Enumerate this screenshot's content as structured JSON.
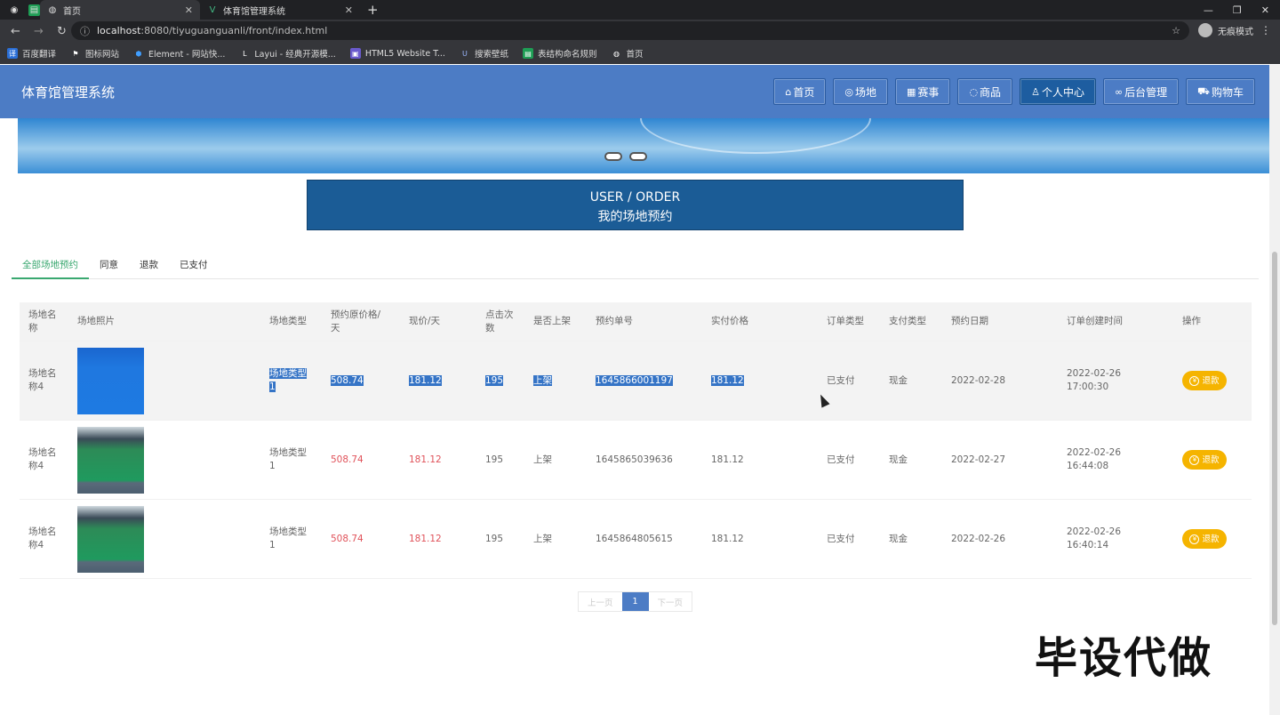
{
  "browser": {
    "tabs": [
      {
        "title": "首页",
        "active": true
      },
      {
        "title": "体育馆管理系统",
        "active": false
      }
    ],
    "url_host": "localhost",
    "url_rest": ":8080/tiyuguanguanli/front/index.html",
    "incognito_label": "无痕模式",
    "bookmarks": [
      "百度翻译",
      "图标网站",
      "Element - 网站快...",
      "Layui - 经典开源模...",
      "HTML5 Website T...",
      "搜索壁纸",
      "表结构命名规则",
      "首页"
    ]
  },
  "site": {
    "brand": "体育馆管理系统",
    "nav": [
      {
        "icon": "home-icon",
        "glyph": "⌂",
        "label": "首页",
        "active": false
      },
      {
        "icon": "venue-icon",
        "glyph": "◎",
        "label": "场地",
        "active": false
      },
      {
        "icon": "calendar-icon",
        "glyph": "▦",
        "label": "赛事",
        "active": false
      },
      {
        "icon": "goods-icon",
        "glyph": "◌",
        "label": "商品",
        "active": false
      },
      {
        "icon": "user-icon",
        "glyph": "♙",
        "label": "个人中心",
        "active": true
      },
      {
        "icon": "link-icon",
        "glyph": "∞",
        "label": "后台管理",
        "active": false
      },
      {
        "icon": "cart-icon",
        "glyph": "⛟",
        "label": "购物车",
        "active": false
      }
    ]
  },
  "section": {
    "title_en": "USER / ORDER",
    "title_cn": "我的场地预约"
  },
  "filter_tabs": [
    {
      "label": "全部场地预约",
      "active": true
    },
    {
      "label": "同意",
      "active": false
    },
    {
      "label": "退款",
      "active": false
    },
    {
      "label": "已支付",
      "active": false
    }
  ],
  "table": {
    "headers": [
      "场地名称",
      "场地照片",
      "场地类型",
      "预约原价格/天",
      "现价/天",
      "点击次数",
      "是否上架",
      "预约单号",
      "实付价格",
      "订单类型",
      "支付类型",
      "预约日期",
      "订单创建时间",
      "操作"
    ],
    "rows": [
      {
        "name": "场地名称4",
        "type": "场地类型1",
        "original_price": "508.74",
        "price": "181.12",
        "clicks": "195",
        "shelf": "上架",
        "order_no": "1645866001197",
        "paid": "181.12",
        "order_type": "已支付",
        "pay_type": "现金",
        "date": "2022-02-28",
        "created": "2022-02-26 17:00:30",
        "action": "退款"
      },
      {
        "name": "场地名称4",
        "type": "场地类型1",
        "original_price": "508.74",
        "price": "181.12",
        "clicks": "195",
        "shelf": "上架",
        "order_no": "1645865039636",
        "paid": "181.12",
        "order_type": "已支付",
        "pay_type": "现金",
        "date": "2022-02-27",
        "created": "2022-02-26 16:44:08",
        "action": "退款"
      },
      {
        "name": "场地名称4",
        "type": "场地类型1",
        "original_price": "508.74",
        "price": "181.12",
        "clicks": "195",
        "shelf": "上架",
        "order_no": "1645864805615",
        "paid": "181.12",
        "order_type": "已支付",
        "pay_type": "现金",
        "date": "2022-02-26",
        "created": "2022-02-26 16:40:14",
        "action": "退款"
      }
    ]
  },
  "pagination": {
    "prev": "上一页",
    "current": "1",
    "next": "下一页"
  },
  "watermark": "毕设代做",
  "colors": {
    "header": "#4c7cc5",
    "active_nav": "#1d5da0",
    "accent_green": "#3aa870",
    "refund": "#f5b400",
    "price_red": "#e0525a"
  }
}
